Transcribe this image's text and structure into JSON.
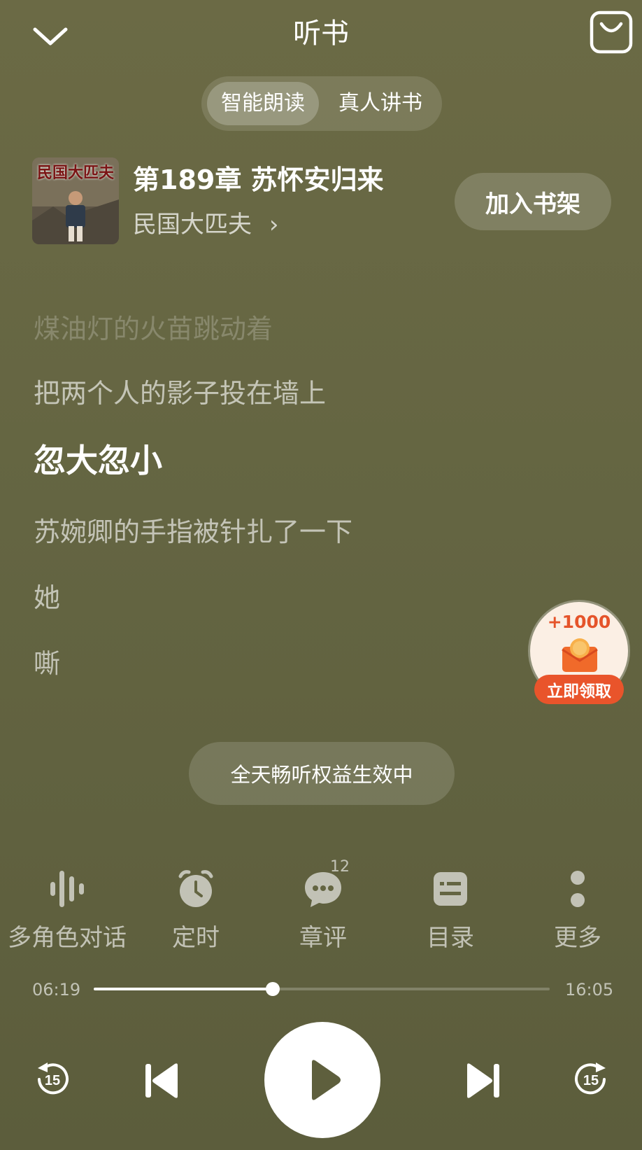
{
  "header": {
    "title": "听书"
  },
  "tabs": [
    {
      "label": "智能朗读",
      "active": true
    },
    {
      "label": "真人讲书",
      "active": false
    }
  ],
  "book": {
    "chapter_title": "第189章 苏怀安归来",
    "name": "民国大匹夫",
    "name_arrow": "›",
    "cover_title": "民国大匹夫",
    "add_shelf_label": "加入书架"
  },
  "lyrics": [
    "煤油灯的火苗跳动着",
    "把两个人的影子投在墙上",
    "忽大忽小",
    "苏婉卿的手指被针扎了一下",
    "她",
    "嘶"
  ],
  "reward": {
    "amount": "+1000",
    "button_label": "立即领取"
  },
  "notice": "全天畅听权益生效中",
  "functions": {
    "multi_role": "多角色对话",
    "timer": "定时",
    "comment": "章评",
    "comment_count": "12",
    "toc": "目录",
    "more": "更多"
  },
  "progress": {
    "current": "06:19",
    "total": "16:05",
    "fraction": 0.393
  },
  "controls": {
    "rewind_seconds": "15",
    "forward_seconds": "15"
  },
  "colors": {
    "background": "#656642",
    "reward_accent": "#e9542b"
  }
}
